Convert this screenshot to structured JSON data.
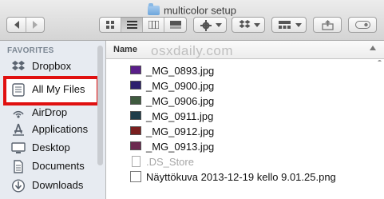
{
  "window": {
    "title": "multicolor setup"
  },
  "toolbar": {
    "view_modes": [
      "icon-view",
      "list-view",
      "column-view",
      "cover-flow-view"
    ],
    "selected_view": "list-view",
    "action_icon": "gear-icon",
    "dropbox_icon": "dropbox-icon",
    "arrange_icon": "arrange-icon",
    "share_icon": "share-icon",
    "tag_icon": "tag-icon"
  },
  "sidebar": {
    "header": "FAVORITES",
    "items": [
      {
        "label": "Dropbox",
        "icon": "dropbox-icon"
      },
      {
        "label": "All My Files",
        "icon": "all-my-files-icon",
        "highlighted": true
      },
      {
        "label": "AirDrop",
        "icon": "airdrop-icon"
      },
      {
        "label": "Applications",
        "icon": "applications-icon"
      },
      {
        "label": "Desktop",
        "icon": "desktop-icon"
      },
      {
        "label": "Documents",
        "icon": "documents-icon"
      },
      {
        "label": "Downloads",
        "icon": "downloads-icon"
      }
    ]
  },
  "file_list": {
    "column_header": "Name",
    "watermark": "osxdaily.com",
    "files": [
      {
        "name": "_MG_0893.jpg",
        "color": "#5a1f8a"
      },
      {
        "name": "_MG_0900.jpg",
        "color": "#2c1f6e"
      },
      {
        "name": "_MG_0906.jpg",
        "color": "#3f5a3f"
      },
      {
        "name": "_MG_0911.jpg",
        "color": "#1f3d4a"
      },
      {
        "name": "_MG_0912.jpg",
        "color": "#7a1f1f"
      },
      {
        "name": "_MG_0913.jpg",
        "color": "#6b2a4f"
      },
      {
        "name": ".DS_Store",
        "color": "#ffffff",
        "hidden": true
      },
      {
        "name": "Näyttökuva 2013-12-19 kello 9.01.25.png",
        "color": "#ffffff"
      }
    ]
  },
  "colors": {
    "highlight": "#e01010",
    "sidebar_bg": "#e7ebf1"
  }
}
